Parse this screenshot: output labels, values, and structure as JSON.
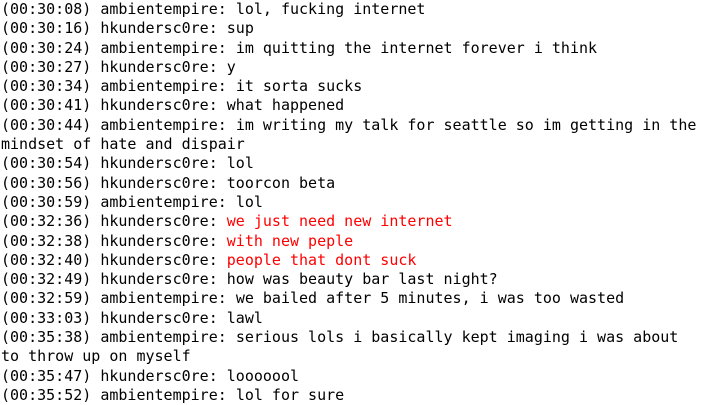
{
  "colors": {
    "background": "#ffffff",
    "text": "#000000",
    "highlight": "#ff0000"
  },
  "messages": [
    {
      "time": "(00:30:08)",
      "user": "ambientempire:",
      "text": "lol, fucking internet"
    },
    {
      "time": "(00:30:16)",
      "user": "hkundersc0re:",
      "text": "sup"
    },
    {
      "time": "(00:30:24)",
      "user": "ambientempire:",
      "text": "im quitting the internet forever i think"
    },
    {
      "time": "(00:30:27)",
      "user": "hkundersc0re:",
      "text": "y"
    },
    {
      "time": "(00:30:34)",
      "user": "ambientempire:",
      "text": "it sorta sucks"
    },
    {
      "time": "(00:30:41)",
      "user": "hkundersc0re:",
      "text": "what happened"
    },
    {
      "time": "(00:30:44)",
      "user": "ambientempire:",
      "text": "im writing my talk for seattle so im getting in the mindset of hate and dispair"
    },
    {
      "time": "(00:30:54)",
      "user": "hkundersc0re:",
      "text": "lol"
    },
    {
      "time": "(00:30:56)",
      "user": "hkundersc0re:",
      "text": "toorcon beta"
    },
    {
      "time": "(00:30:59)",
      "user": "ambientempire:",
      "text": "lol"
    },
    {
      "time": "(00:32:36)",
      "user": "hkundersc0re:",
      "text": "we just need new internet",
      "highlight": true
    },
    {
      "time": "(00:32:38)",
      "user": "hkundersc0re:",
      "text": "with new peple",
      "highlight": true
    },
    {
      "time": "(00:32:40)",
      "user": "hkundersc0re:",
      "text": "people that dont suck",
      "highlight": true
    },
    {
      "time": "(00:32:49)",
      "user": "hkundersc0re:",
      "text": "how was beauty bar last night?"
    },
    {
      "time": "(00:32:59)",
      "user": "ambientempire:",
      "text": "we bailed after 5 minutes, i was too wasted"
    },
    {
      "time": "(00:33:03)",
      "user": "hkundersc0re:",
      "text": "lawl"
    },
    {
      "time": "(00:35:38)",
      "user": "ambientempire:",
      "text": "serious lols i basically kept imaging i was about to throw up on myself"
    },
    {
      "time": "(00:35:47)",
      "user": "hkundersc0re:",
      "text": "looooool"
    },
    {
      "time": "(00:35:52)",
      "user": "ambientempire:",
      "text": "lol for sure"
    }
  ]
}
